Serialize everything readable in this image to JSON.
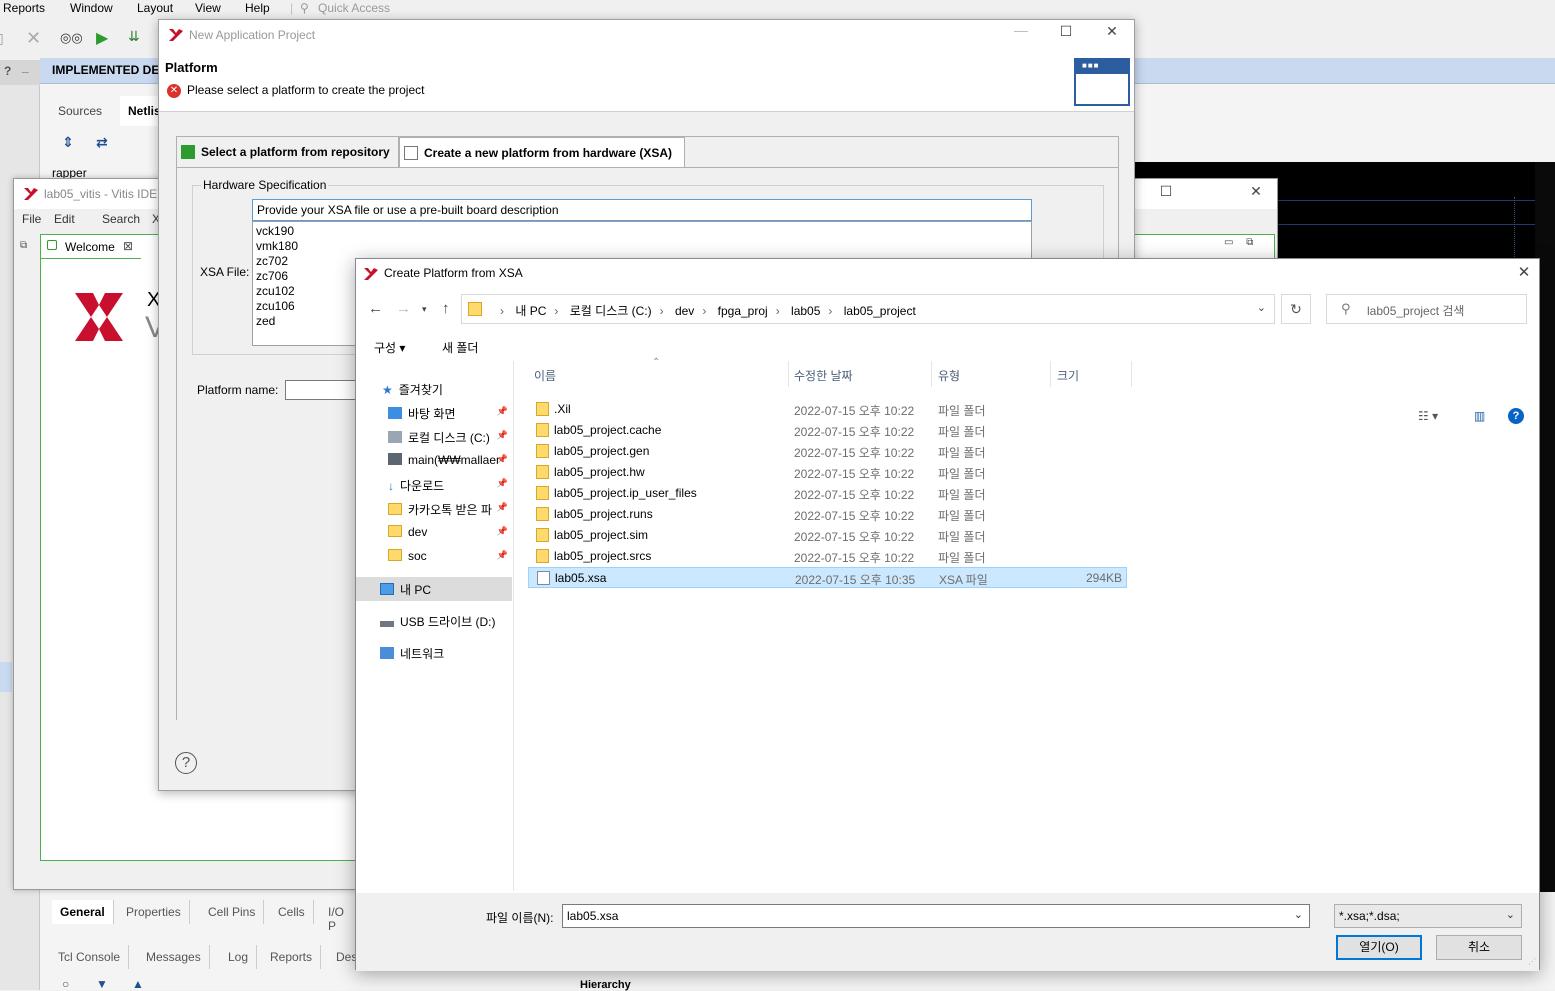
{
  "vivado": {
    "menu": [
      "Reports",
      "Window",
      "Layout",
      "View",
      "Help"
    ],
    "quick_access": "Quick Access",
    "flow_nav_label": "?",
    "impl_header": "IMPLEMENTED DES",
    "sources_tabs": [
      "Sources",
      "Netlis"
    ],
    "tree_item": "rapper",
    "bottom_tabs1": [
      "General",
      "Properties",
      "Cell Pins",
      "Cells",
      "I/O P"
    ],
    "bottom_tabs2": [
      "Tcl Console",
      "Messages",
      "Log",
      "Reports",
      "Des"
    ],
    "hierarchy_label": "Hierarchy"
  },
  "vitis": {
    "title": "lab05_vitis - Vitis IDE",
    "menu": [
      "File",
      "Edit",
      "Search",
      "X"
    ],
    "welcome_tab": "Welcome",
    "logo_letters": "X",
    "logo_letters2": "V"
  },
  "nap": {
    "title": "New Application Project",
    "header_title": "Platform",
    "error_msg": "Please select a platform to create the project",
    "tab_repo": "Select a platform from repository",
    "tab_xsa": "Create a new platform from hardware (XSA)",
    "group_label": "Hardware Specification",
    "xsa_label": "XSA File:",
    "xsa_placeholder": "Provide your XSA file or use a pre-built board description",
    "boards": [
      "vck190",
      "vmk180",
      "zc702",
      "zc706",
      "zcu102",
      "zcu106",
      "zed"
    ],
    "platform_name_label": "Platform name:",
    "help": "?"
  },
  "cpx": {
    "title": "Create Platform from XSA",
    "breadcrumbs": [
      "내 PC",
      "로컬 디스크 (C:)",
      "dev",
      "fpga_proj",
      "lab05",
      "lab05_project"
    ],
    "search_placeholder": "lab05_project 검색",
    "organize": "구성 ▾",
    "new_folder": "새 폴더",
    "nav": [
      {
        "label": "즐겨찾기"
      },
      {
        "label": "바탕 화면"
      },
      {
        "label": "로컬 디스크 (C:)"
      },
      {
        "label": "main(₩₩mallaer"
      },
      {
        "label": "다운로드"
      },
      {
        "label": "카카오톡 받은 파"
      },
      {
        "label": "dev"
      },
      {
        "label": "soc"
      },
      {
        "label": "내 PC"
      },
      {
        "label": "USB 드라이브 (D:)"
      },
      {
        "label": "네트워크"
      }
    ],
    "columns": [
      "이름",
      "수정한 날짜",
      "유형",
      "크기"
    ],
    "files": [
      {
        "name": ".Xil",
        "date": "2022-07-15 오후 10:22",
        "type": "파일 폴더",
        "size": ""
      },
      {
        "name": "lab05_project.cache",
        "date": "2022-07-15 오후 10:22",
        "type": "파일 폴더",
        "size": ""
      },
      {
        "name": "lab05_project.gen",
        "date": "2022-07-15 오후 10:22",
        "type": "파일 폴더",
        "size": ""
      },
      {
        "name": "lab05_project.hw",
        "date": "2022-07-15 오후 10:22",
        "type": "파일 폴더",
        "size": ""
      },
      {
        "name": "lab05_project.ip_user_files",
        "date": "2022-07-15 오후 10:22",
        "type": "파일 폴더",
        "size": ""
      },
      {
        "name": "lab05_project.runs",
        "date": "2022-07-15 오후 10:22",
        "type": "파일 폴더",
        "size": ""
      },
      {
        "name": "lab05_project.sim",
        "date": "2022-07-15 오후 10:22",
        "type": "파일 폴더",
        "size": ""
      },
      {
        "name": "lab05_project.srcs",
        "date": "2022-07-15 오후 10:22",
        "type": "파일 폴더",
        "size": ""
      },
      {
        "name": "lab05.xsa",
        "date": "2022-07-15 오후 10:35",
        "type": "XSA 파일",
        "size": "294KB"
      }
    ],
    "filename_label": "파일 이름(N):",
    "filename_value": "lab05.xsa",
    "filetype_value": "*.xsa;*.dsa;",
    "open_label": "열기(O)",
    "cancel_label": "취소",
    "help_glyph": "?"
  },
  "colors": {
    "accent": "#0078d7",
    "selection": "#cce8ff",
    "error": "#d9342b",
    "vivado_header": "#c9d9f0"
  }
}
